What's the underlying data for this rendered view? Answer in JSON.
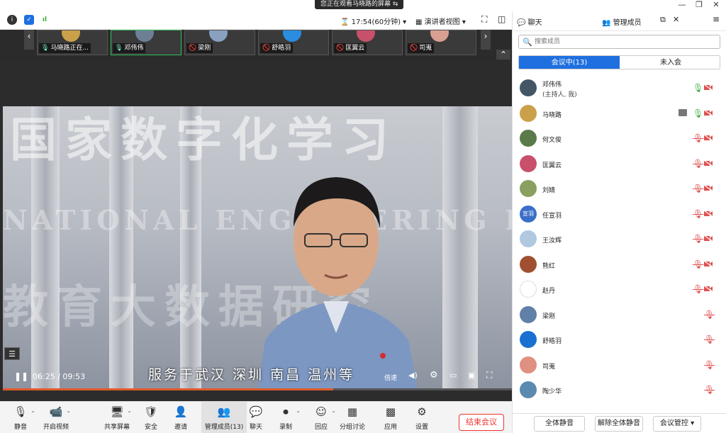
{
  "window": {
    "share_banner": "您正在观看马晓路的屏幕",
    "minimize": "—",
    "restore": "❐",
    "close": "✕"
  },
  "toolbar": {
    "timer": "17:54(60分钟)",
    "view_mode": "演讲者视图"
  },
  "thumbs": [
    {
      "label": "马晓路正在...",
      "color": "#caa04a"
    },
    {
      "label": "邓伟伟",
      "color": "#6d7f95"
    },
    {
      "label": "梁刚",
      "color": "#8aa0c0"
    },
    {
      "label": "舒皓羽",
      "color": "#2a8de0"
    },
    {
      "label": "匡翼云",
      "color": "#c8506a"
    },
    {
      "label": "司嵬",
      "color": "#d8a090"
    }
  ],
  "video": {
    "current_time": "06:25",
    "duration": "09:53",
    "progress": 0.649,
    "subtitle": "服务于武汉  深圳  南昌  温州等",
    "speed_label": "倍速",
    "bg_text_1": "国家数字化学习",
    "bg_text_2": "NATIONAL ENGINEERING RES",
    "bg_text_3": "教育大数据研究"
  },
  "bottombar": {
    "items": [
      {
        "label": "静音",
        "icon": "🎙"
      },
      {
        "label": "开启视频",
        "icon": "📹"
      },
      {
        "label": "共享屏幕",
        "icon": "🖥"
      },
      {
        "label": "安全",
        "icon": "🛡"
      },
      {
        "label": "邀请",
        "icon": "👤"
      },
      {
        "label": "管理成员(13)",
        "icon": "👥"
      },
      {
        "label": "聊天",
        "icon": "💬"
      },
      {
        "label": "录制",
        "icon": "⏺"
      },
      {
        "label": "回应",
        "icon": "☺"
      },
      {
        "label": "分组讨论",
        "icon": "▦"
      },
      {
        "label": "应用",
        "icon": "▩"
      },
      {
        "label": "设置",
        "icon": "⚙"
      }
    ],
    "end_meeting": "结束会议"
  },
  "panel": {
    "tab_chat": "聊天",
    "tab_members": "管理成员",
    "search_placeholder": "搜索成员",
    "seg_in_meeting": "会议中(13)",
    "seg_not_joined": "未入会",
    "members": [
      {
        "name": "邓伟伟",
        "sub": "(主持人, 我)",
        "color": "#445566",
        "mic_on": true,
        "cam": true,
        "share": false
      },
      {
        "name": "马晓路",
        "sub": "",
        "color": "#caa04a",
        "mic_on": true,
        "cam": true,
        "share": true
      },
      {
        "name": "何文俊",
        "sub": "",
        "color": "#5a7a4a",
        "mic_on": false,
        "cam": true,
        "share": false
      },
      {
        "name": "匡翼云",
        "sub": "",
        "color": "#c8506a",
        "mic_on": false,
        "cam": true,
        "share": false
      },
      {
        "name": "刘婧",
        "sub": "",
        "color": "#8aa060",
        "mic_on": false,
        "cam": true,
        "share": false
      },
      {
        "name": "任宣羽",
        "sub": "",
        "color": "#3a6ec8",
        "mic_on": false,
        "cam": true,
        "share": false,
        "initials": "宣羽"
      },
      {
        "name": "王汝辉",
        "sub": "",
        "color": "#b0c8e0",
        "mic_on": false,
        "cam": true,
        "share": false
      },
      {
        "name": "熊红",
        "sub": "",
        "color": "#a05030",
        "mic_on": false,
        "cam": true,
        "share": false
      },
      {
        "name": "赵丹",
        "sub": "",
        "color": "#ffffff",
        "mic_on": false,
        "cam": true,
        "share": false
      },
      {
        "name": "梁刚",
        "sub": "",
        "color": "#6080a8",
        "mic_on": false,
        "cam": false,
        "share": false
      },
      {
        "name": "舒皓羽",
        "sub": "",
        "color": "#1a70d0",
        "mic_on": false,
        "cam": false,
        "share": false
      },
      {
        "name": "司嵬",
        "sub": "",
        "color": "#e09080",
        "mic_on": false,
        "cam": false,
        "share": false
      },
      {
        "name": "陶少华",
        "sub": "",
        "color": "#5a8ab0",
        "mic_on": false,
        "cam": false,
        "share": false
      }
    ],
    "mute_all": "全体静音",
    "unmute_all": "解除全体静音",
    "meeting_control": "会议管控"
  },
  "colors": {
    "accent": "#1e6fe0",
    "end_red": "#e33333",
    "mic_green": "#3aaa3a",
    "muted_red": "#e05050"
  }
}
